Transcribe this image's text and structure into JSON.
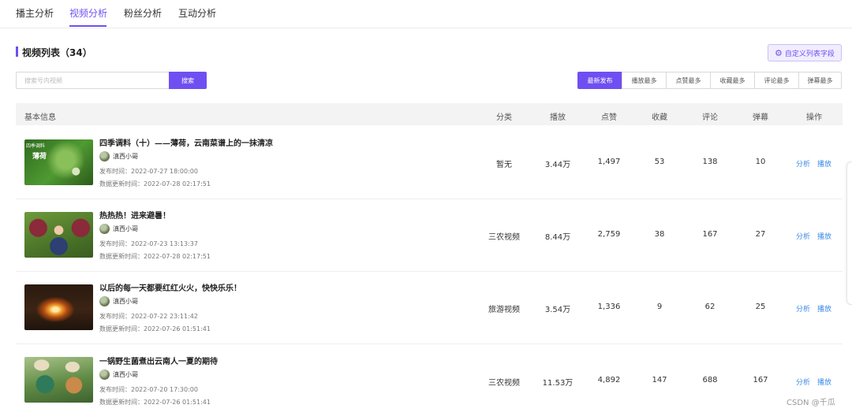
{
  "tabs": [
    {
      "label": "播主分析",
      "active": false
    },
    {
      "label": "视频分析",
      "active": true
    },
    {
      "label": "粉丝分析",
      "active": false
    },
    {
      "label": "互动分析",
      "active": false
    }
  ],
  "section": {
    "title": "视频列表（34）",
    "custom_button_label": "自定义列表字段",
    "custom_button_icon": "gear-icon"
  },
  "search": {
    "placeholder": "搜索号内视频",
    "value": "",
    "button_label": "搜索"
  },
  "sort_options": [
    {
      "label": "最新发布",
      "active": true
    },
    {
      "label": "播放最多",
      "active": false
    },
    {
      "label": "点赞最多",
      "active": false
    },
    {
      "label": "收藏最多",
      "active": false
    },
    {
      "label": "评论最多",
      "active": false
    },
    {
      "label": "弹幕最多",
      "active": false
    }
  ],
  "columns": {
    "info": "基本信息",
    "category": "分类",
    "plays": "播放",
    "likes": "点赞",
    "favorites": "收藏",
    "comments": "评论",
    "danmaku": "弹幕",
    "actions": "操作"
  },
  "videos": [
    {
      "title": "四季调料（十）——薄荷，云南菜谱上的一抹清凉",
      "author": "滇西小哥",
      "publish_time": "发布时间：2022-07-27 18:00:00",
      "update_time": "数据更新时间：2022-07-28 02:17:51",
      "category": "暂无",
      "plays": "3.44万",
      "likes": "1,497",
      "favorites": "53",
      "comments": "138",
      "danmaku": "10",
      "analyze": "分析",
      "play": "播放",
      "thumb_text": "四季调料",
      "thumb_text2": "薄荷"
    },
    {
      "title": "热热热！进来避暑！",
      "author": "滇西小哥",
      "publish_time": "发布时间：2022-07-23 13:13:37",
      "update_time": "数据更新时间：2022-07-28 02:17:51",
      "category": "三农视频",
      "plays": "8.44万",
      "likes": "2,759",
      "favorites": "38",
      "comments": "167",
      "danmaku": "27",
      "analyze": "分析",
      "play": "播放"
    },
    {
      "title": "以后的每一天都要红红火火，快快乐乐！",
      "author": "滇西小哥",
      "publish_time": "发布时间：2022-07-22 23:11:42",
      "update_time": "数据更新时间：2022-07-26 01:51:41",
      "category": "旅游视频",
      "plays": "3.54万",
      "likes": "1,336",
      "favorites": "9",
      "comments": "62",
      "danmaku": "25",
      "analyze": "分析",
      "play": "播放"
    },
    {
      "title": "一锅野生菌煮出云南人一夏的期待",
      "author": "滇西小哥",
      "publish_time": "发布时间：2022-07-20 17:30:00",
      "update_time": "数据更新时间：2022-07-26 01:51:41",
      "category": "三农视频",
      "plays": "11.53万",
      "likes": "4,892",
      "favorites": "147",
      "comments": "688",
      "danmaku": "167",
      "analyze": "分析",
      "play": "播放"
    }
  ],
  "watermark": "CSDN @千瓜",
  "colors": {
    "accent": "#6f4ff2",
    "link": "#3b8be6"
  }
}
